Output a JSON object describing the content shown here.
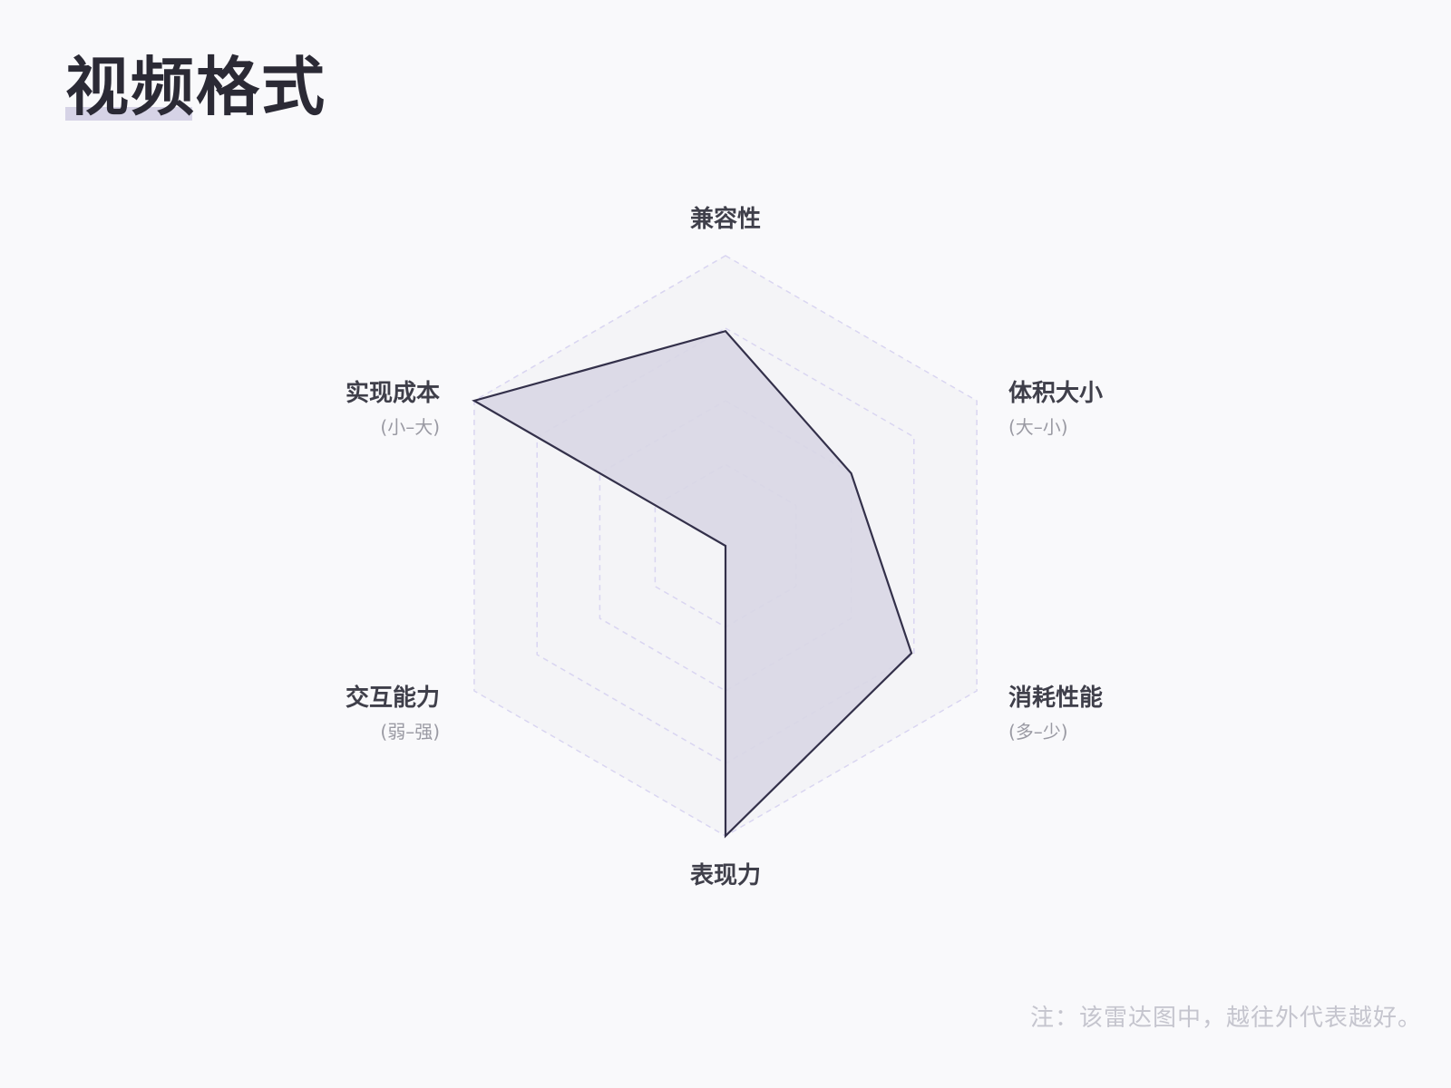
{
  "page": {
    "title": "视频格式",
    "footnote": "注：该雷达图中，越往外代表越好。"
  },
  "colors": {
    "background": "#f9f9fb",
    "title": "#2b2a35",
    "title_underline": "#d6d3e6",
    "grid": "#d9d5f1",
    "web_fill": "#f4f4f7",
    "area_fill": "#d9d7e5",
    "area_stroke": "#33304a",
    "axis_label": "#3f3f4a",
    "axis_sublabel": "#9a9aa3",
    "footnote": "#c5c5ce"
  },
  "chart_data": {
    "type": "radar",
    "axes": [
      {
        "label": "兼容性",
        "sublabel": ""
      },
      {
        "label": "体积大小",
        "sublabel": "(大–小)"
      },
      {
        "label": "消耗性能",
        "sublabel": "(多–少)"
      },
      {
        "label": "表现力",
        "sublabel": ""
      },
      {
        "label": "交互能力",
        "sublabel": "(弱–强)"
      },
      {
        "label": "实现成本",
        "sublabel": "(小–大)"
      }
    ],
    "levels": [
      0.28,
      0.5,
      0.75,
      1.0
    ],
    "range": [
      0,
      1
    ],
    "series": [
      {
        "values": [
          0.74,
          0.5,
          0.74,
          1.0,
          0.0,
          1.0
        ]
      }
    ]
  }
}
